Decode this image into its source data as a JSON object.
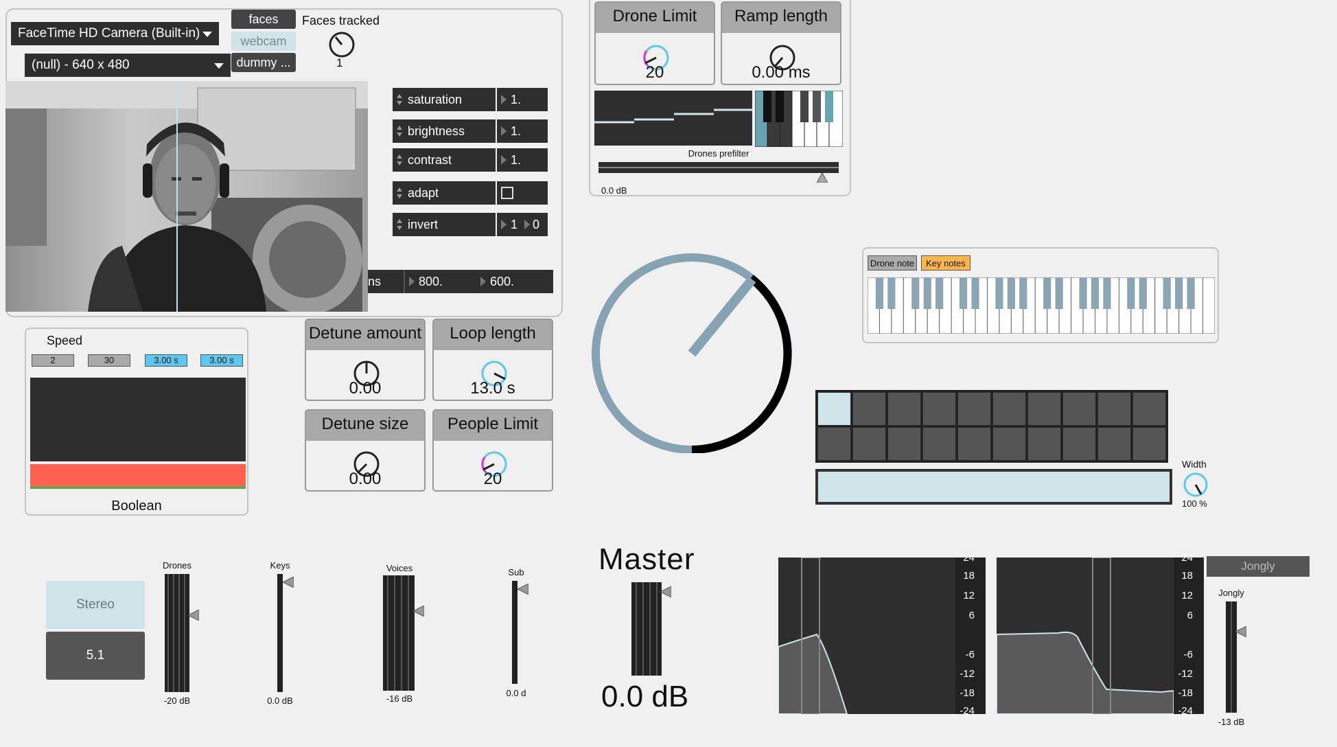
{
  "camera": {
    "device": "FaceTime HD Camera (Built-in)",
    "format": "(null) - 640 x 480",
    "tabs": [
      "faces",
      "webcam",
      "dummy ..."
    ],
    "faces_tracked_label": "Faces tracked",
    "faces_tracked_value": "1",
    "attributes": [
      {
        "name": "saturation",
        "value": "1."
      },
      {
        "name": "brightness",
        "value": "1."
      },
      {
        "name": "contrast",
        "value": "1."
      },
      {
        "name": "adapt",
        "value": ""
      },
      {
        "name": "invert",
        "value": "1",
        "value2": "0"
      }
    ],
    "dims": {
      "label": "ns",
      "w": "800.",
      "h": "600."
    }
  },
  "speed": {
    "title": "Speed",
    "boxes": [
      "2",
      "30",
      "3.00 s",
      "3.00 s"
    ],
    "footer": "Boolean"
  },
  "knobs": {
    "detune_amount": {
      "title": "Detune amount",
      "value": "0.00"
    },
    "loop_length": {
      "title": "Loop length",
      "value": "13.0 s"
    },
    "detune_size": {
      "title": "Detune size",
      "value": "0.00"
    },
    "people_limit": {
      "title": "People Limit",
      "value": "20"
    },
    "drone_limit": {
      "title": "Drone Limit",
      "value": "20"
    },
    "ramp_length": {
      "title": "Ramp length",
      "value": "0.00 ms"
    }
  },
  "prefilter": {
    "label": "Drones prefilter",
    "gain": "0.0 dB"
  },
  "keys_panel": {
    "drone_note": "Drone note",
    "key_notes": "Key notes"
  },
  "width": {
    "label": "Width",
    "value": "100 %"
  },
  "output": {
    "stereo": "Stereo",
    "surround": "5.1"
  },
  "meters": [
    {
      "name": "Drones",
      "value": "-20 dB"
    },
    {
      "name": "Keys",
      "value": "0.0 dB"
    },
    {
      "name": "Voices",
      "value": "-16 dB"
    },
    {
      "name": "Sub",
      "value": "0.0 d"
    }
  ],
  "master": {
    "label": "Master",
    "value": "0.0 dB"
  },
  "eq": {
    "ticks": [
      "24",
      "18",
      "12",
      "6",
      "-6",
      "-12",
      "-18",
      "-24"
    ],
    "jongly_button": "Jongly",
    "jongly_label": "Jongly",
    "jongly_value": "-13 dB"
  },
  "colors": {
    "accent": "#5bc8ef",
    "highlight": "#ffb646",
    "boolean_bar": "#ff6150",
    "light_cyan": "#cfe4e8",
    "dial": "#86a3b3"
  }
}
